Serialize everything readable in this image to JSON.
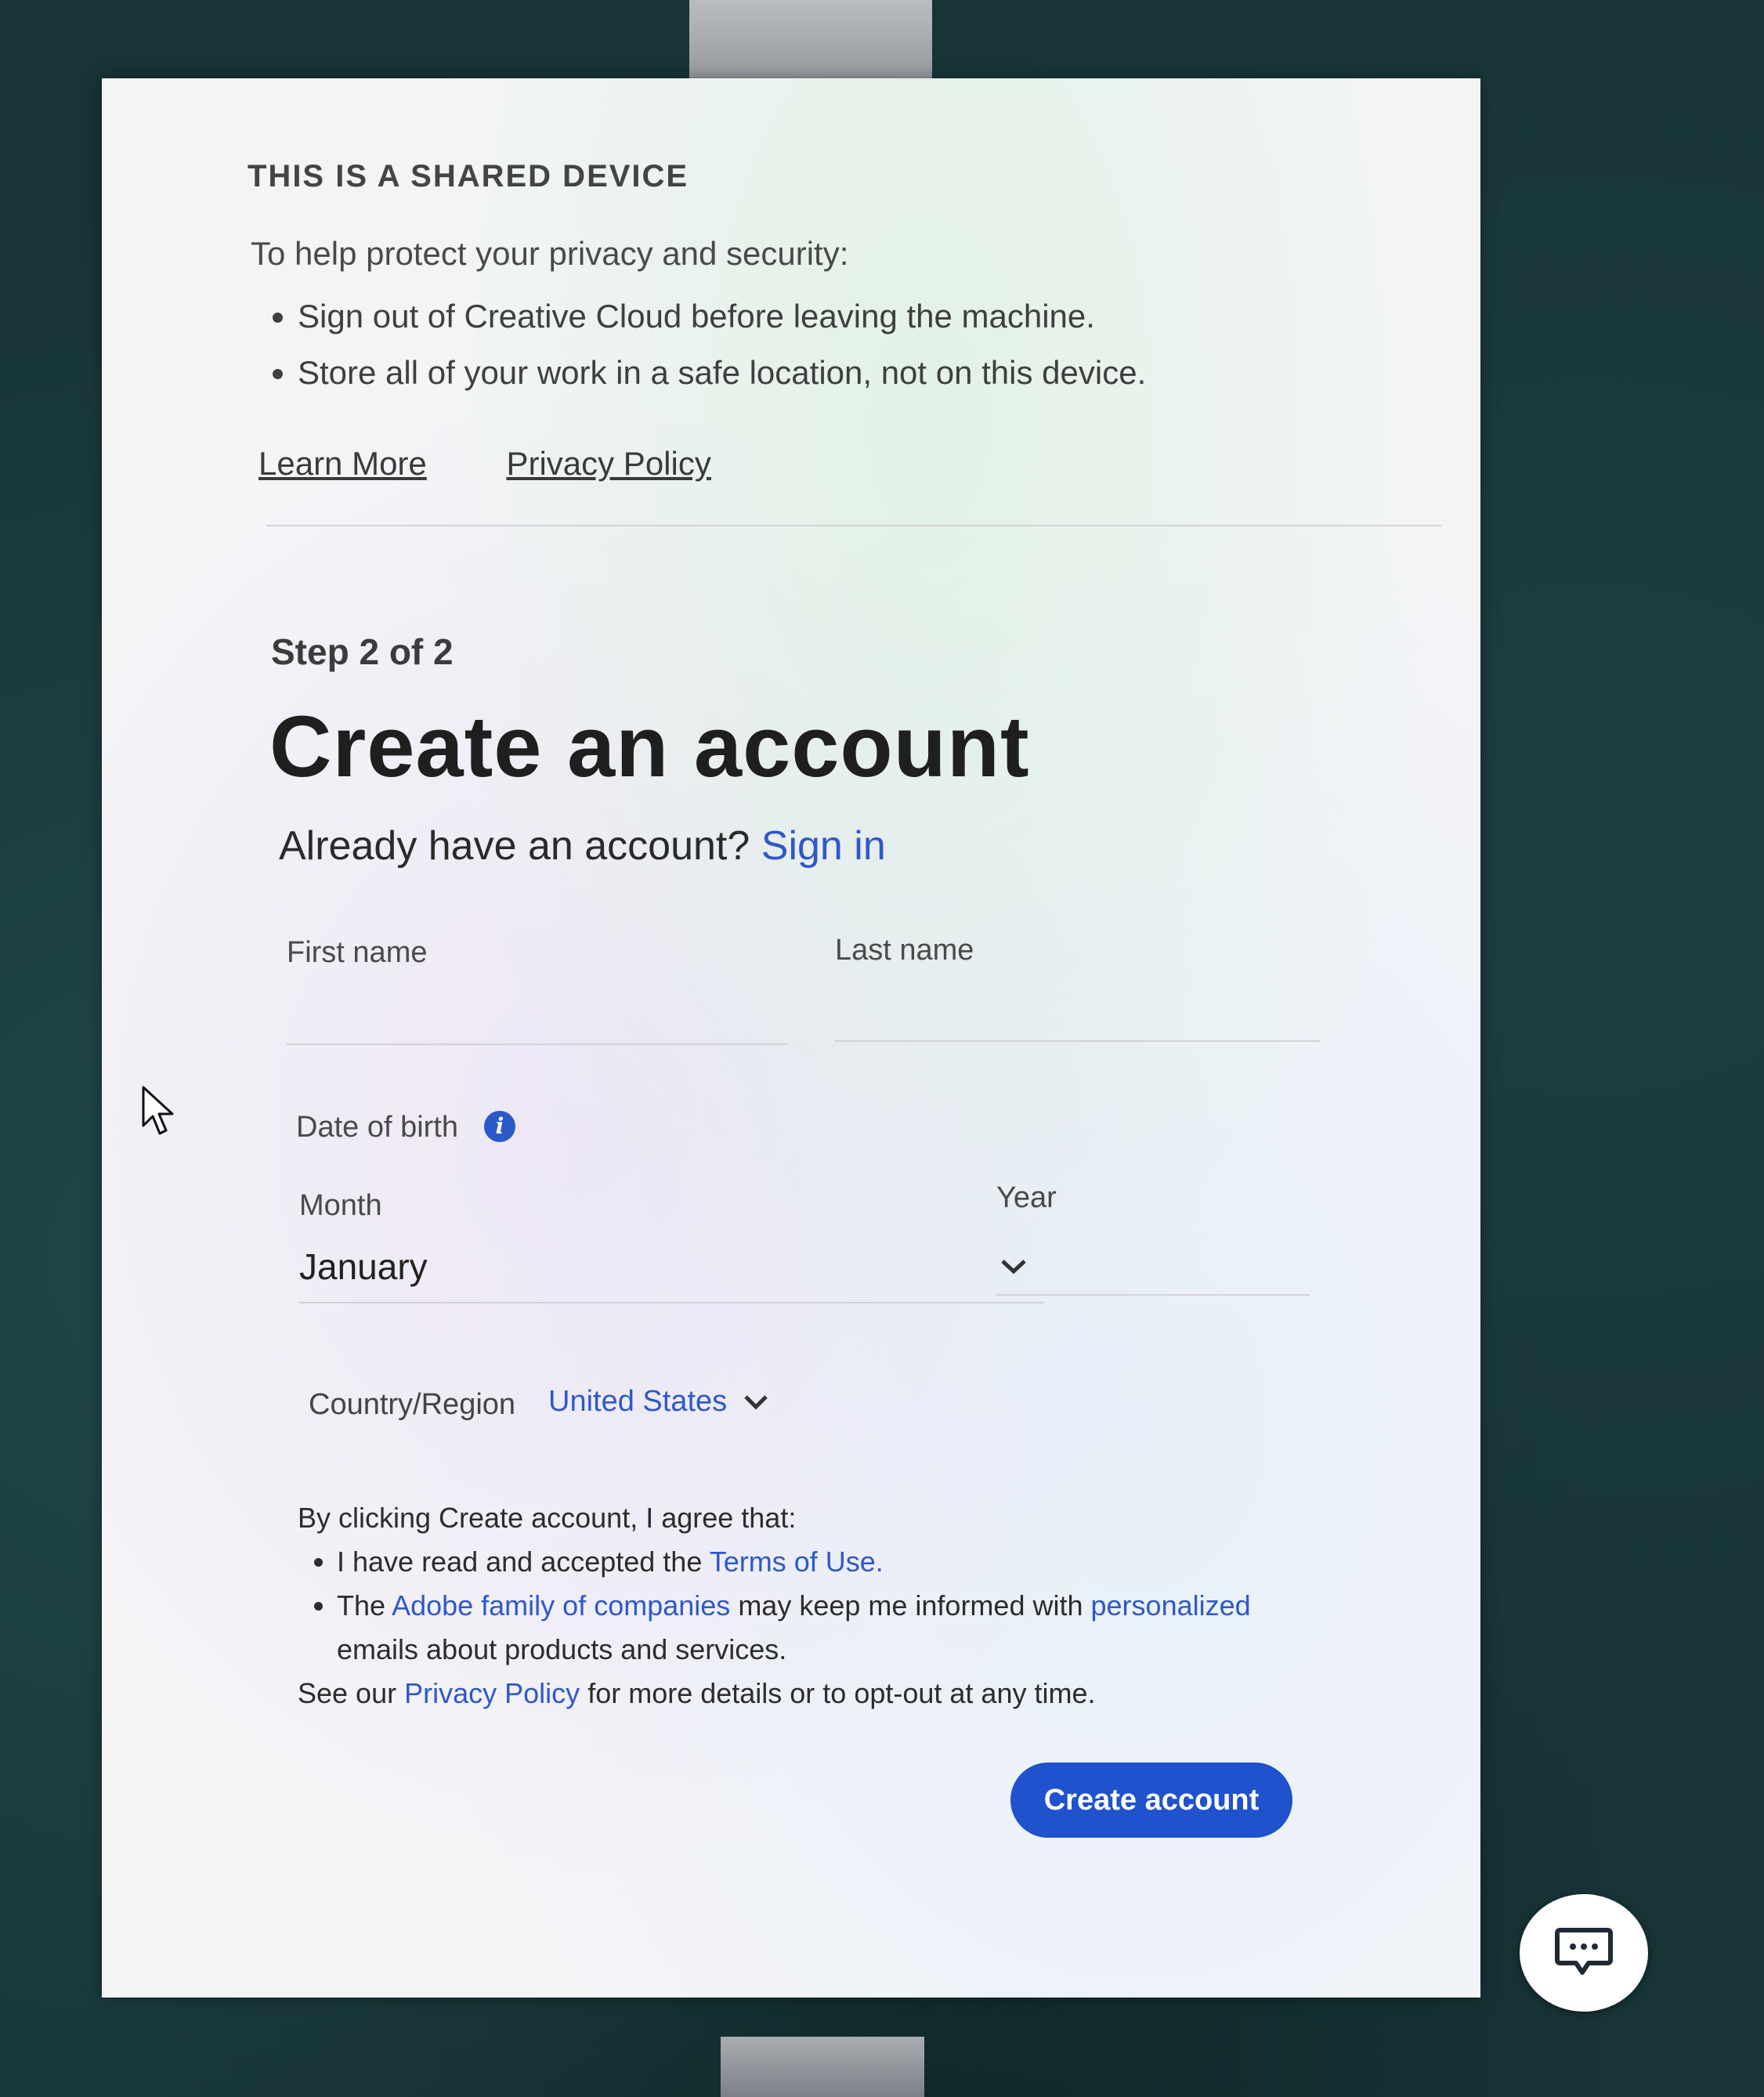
{
  "shared_device": {
    "title": "THIS IS A SHARED DEVICE",
    "intro": "To help protect your privacy and security:",
    "bullets": [
      "Sign out of Creative Cloud before leaving the machine.",
      "Store all of your work in a safe location, not on this device."
    ],
    "learn_more": "Learn More",
    "privacy_policy": "Privacy Policy"
  },
  "form": {
    "step": "Step 2 of 2",
    "heading": "Create an account",
    "already_prefix": "Already have an account?",
    "sign_in": "Sign in",
    "first_name_label": "First name",
    "first_name_value": "",
    "last_name_label": "Last name",
    "last_name_value": "",
    "dob_label": "Date of birth",
    "month_label": "Month",
    "month_value": "January",
    "year_label": "Year",
    "year_value": "",
    "country_label": "Country/Region",
    "country_value": "United States",
    "terms": {
      "intro": "By clicking Create account, I agree that:",
      "item1_prefix": "I have read and accepted the",
      "item1_link": "Terms of Use.",
      "item2_prefix": "The",
      "item2_link1": "Adobe family of companies",
      "item2_mid": "may keep me informed with",
      "item2_link2": "personalized",
      "item2_suffix": "emails about products and services.",
      "footer_prefix": "See our",
      "footer_link": "Privacy Policy",
      "footer_suffix": "for more details or to opt-out at any time."
    },
    "create_button": "Create account"
  },
  "icons": {
    "info": "info-icon",
    "chevron": "chevron-down-icon",
    "chat": "chat-icon",
    "cursor": "mouse-cursor-icon"
  },
  "colors": {
    "accent": "#1f52cc",
    "link": "#2f58c8",
    "panel": "#f4f4f7",
    "background": "#173437"
  }
}
